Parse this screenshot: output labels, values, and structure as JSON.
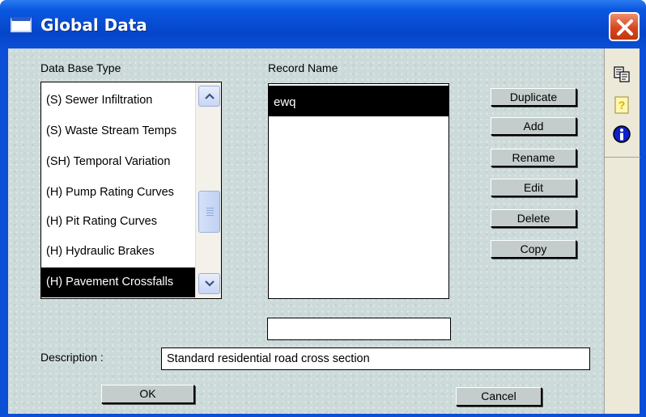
{
  "window": {
    "title": "Global Data"
  },
  "left_panel": {
    "label": "Data Base Type",
    "items": [
      {
        "label": "(S) Sewer Infiltration",
        "selected": false
      },
      {
        "label": "(S) Waste Stream Temps",
        "selected": false
      },
      {
        "label": "(SH) Temporal Variation",
        "selected": false
      },
      {
        "label": "(H) Pump Rating Curves",
        "selected": false
      },
      {
        "label": "(H) Pit Rating Curves",
        "selected": false
      },
      {
        "label": "(H) Hydraulic Brakes",
        "selected": false
      },
      {
        "label": "(H) Pavement Crossfalls",
        "selected": true
      }
    ]
  },
  "record_panel": {
    "label": "Record Name",
    "records": [
      {
        "label": "ewq",
        "selected": true
      }
    ],
    "name_value": ""
  },
  "actions": {
    "duplicate": "Duplicate",
    "add": "Add",
    "rename": "Rename",
    "edit": "Edit",
    "delete": "Delete",
    "copy": "Copy"
  },
  "description": {
    "label": "Description :",
    "value": "Standard residential road cross section"
  },
  "footer": {
    "ok": "OK",
    "cancel": "Cancel"
  },
  "toolbar_icons": [
    "copy-pages-icon",
    "help-question-icon",
    "info-icon"
  ],
  "colors": {
    "titlebar": "#0a4fd6",
    "client_bg": "#cddada",
    "selection": "#000000",
    "close_button": "#d8461e"
  }
}
